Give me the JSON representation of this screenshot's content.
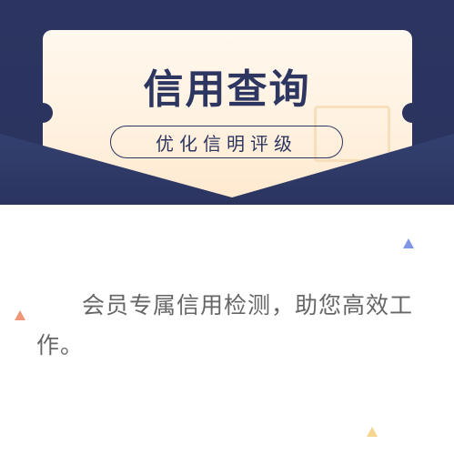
{
  "header": {
    "title": "信用查询",
    "subtitle": "优化信明评级"
  },
  "body": {
    "description": "会员专属信用检测，助您高效工作。"
  },
  "colors": {
    "navy": "#2c3561",
    "cream": "#fff5e8",
    "text": "#666666",
    "tri_blue": "#7f95e6",
    "tri_orange": "#ef9776",
    "tri_yellow": "#f5d58f"
  },
  "icons": {
    "ticket_image": "image-placeholder-icon"
  }
}
